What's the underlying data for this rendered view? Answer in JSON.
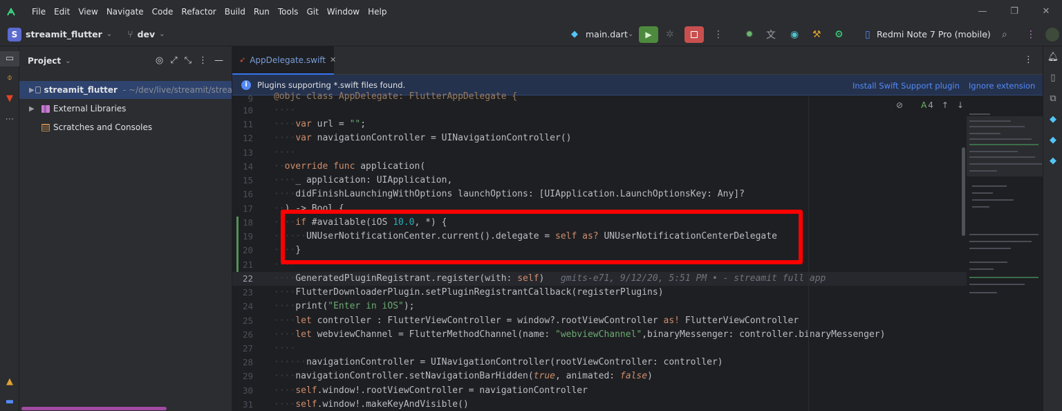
{
  "menubar": {
    "items": [
      "File",
      "Edit",
      "View",
      "Navigate",
      "Code",
      "Refactor",
      "Build",
      "Run",
      "Tools",
      "Git",
      "Window",
      "Help"
    ]
  },
  "toolbar": {
    "project_initial": "S",
    "project_name": "streamit_flutter",
    "branch": "dev",
    "run_config": "main.dart",
    "device": "Redmi Note 7 Pro (mobile)"
  },
  "project_panel": {
    "title": "Project",
    "tree": [
      {
        "name": "streamit_flutter",
        "path": "~/dev/live/streamit/strea"
      },
      {
        "name": "External Libraries"
      },
      {
        "name": "Scratches and Consoles"
      }
    ]
  },
  "editor": {
    "tab_label": "AppDelegate.swift",
    "banner_text": "Plugins supporting *.swift files found.",
    "banner_actions": [
      "Install Swift Support plugin",
      "Ignore extension"
    ],
    "inspection_count": "4",
    "current_line": "22",
    "blame": "gmits-e71, 9/12/20, 5:51 PM • - streamit full app",
    "line_numbers": [
      "9",
      "10",
      "11",
      "12",
      "13",
      "14",
      "15",
      "16",
      "17",
      "18",
      "19",
      "20",
      "21",
      "22",
      "23",
      "24",
      "25",
      "26",
      "27",
      "28",
      "29",
      "30",
      "31"
    ]
  },
  "colors": {
    "accent": "#3574f0",
    "run_green": "#4e8a3e",
    "stop_red": "#c94f4f",
    "annotation_red": "#ff0000"
  }
}
